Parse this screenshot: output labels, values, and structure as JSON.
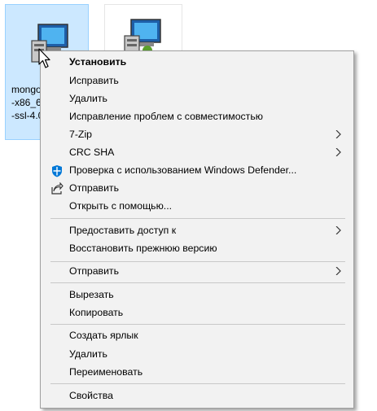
{
  "files": {
    "first_name_lines": "mongo\n-x86_6\n-ssl-4.0"
  },
  "menu": {
    "items": [
      {
        "label": "Установить"
      },
      {
        "label": "Исправить"
      },
      {
        "label": "Удалить"
      },
      {
        "label": "Исправление проблем с совместимостью"
      },
      {
        "label": "7-Zip"
      },
      {
        "label": "CRC SHA"
      },
      {
        "label": "Проверка с использованием Windows Defender..."
      },
      {
        "label": "Отправить"
      },
      {
        "label": "Открыть с помощью..."
      },
      {
        "label": "Предоставить доступ к"
      },
      {
        "label": "Восстановить прежнюю версию"
      },
      {
        "label": "Отправить"
      },
      {
        "label": "Вырезать"
      },
      {
        "label": "Копировать"
      },
      {
        "label": "Создать ярлык"
      },
      {
        "label": "Удалить"
      },
      {
        "label": "Переименовать"
      },
      {
        "label": "Свойства"
      }
    ]
  },
  "icons": {
    "defender": "shield-icon",
    "share": "share-icon",
    "submenu": "chevron-right-icon",
    "installer": "msi-installer-icon",
    "pointer": "mouse-pointer-icon"
  },
  "colors": {
    "selection_bg": "#cce8ff",
    "selection_border": "#99d1ff",
    "menu_bg": "#f2f2f2",
    "defender_blue": "#0078d7"
  }
}
